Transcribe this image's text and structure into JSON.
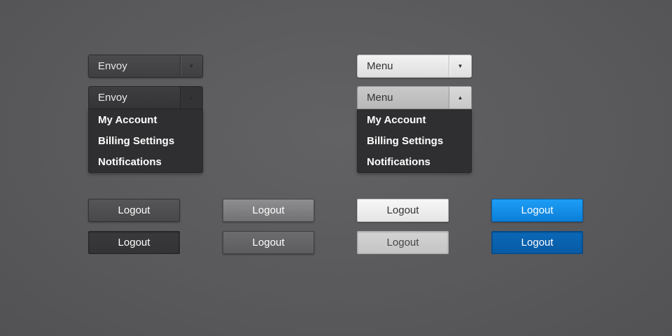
{
  "dropdowns": {
    "dark_closed": {
      "label": "Envoy",
      "arrow_icon": "caret-down"
    },
    "dark_open": {
      "label": "Envoy",
      "arrow_icon": "caret-up",
      "items": [
        "My Account",
        "Billing Settings",
        "Notifications"
      ]
    },
    "light_closed": {
      "label": "Menu",
      "arrow_icon": "caret-down"
    },
    "light_open": {
      "label": "Menu",
      "arrow_icon": "caret-up",
      "items": [
        "My Account",
        "Billing Settings",
        "Notifications"
      ]
    }
  },
  "buttons": {
    "dark_normal": "Logout",
    "dark_pressed": "Logout",
    "grey_hover": "Logout",
    "grey_normal": "Logout",
    "light_normal": "Logout",
    "light_pressed": "Logout",
    "blue_normal": "Logout",
    "blue_pressed": "Logout"
  },
  "colors": {
    "background": "#59595b",
    "blue_accent": "#1591ea",
    "menu_bg": "#2f2f31"
  }
}
